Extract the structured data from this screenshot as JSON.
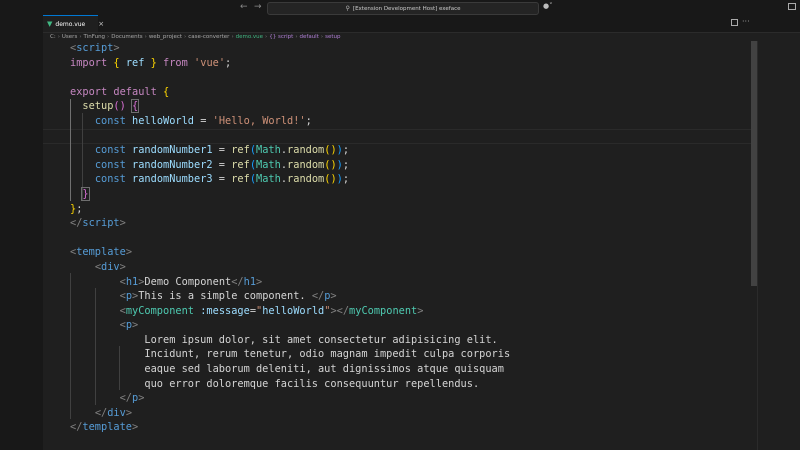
{
  "titlebar": {
    "back_icon": "arrow-left-icon",
    "forward_icon": "arrow-right-icon",
    "command_center": "[Extension Development Host] exeface",
    "copilot_icon": "copilot-icon"
  },
  "tab": {
    "label": "demo.vue",
    "close": "×"
  },
  "breadcrumb": [
    {
      "text": "C:"
    },
    {
      "text": "Users"
    },
    {
      "text": "TinFung"
    },
    {
      "text": "Documents"
    },
    {
      "text": "web_project"
    },
    {
      "text": "case-converter"
    },
    {
      "text": "demo.vue",
      "kind": "vue"
    },
    {
      "text": "{} script",
      "kind": "sym"
    },
    {
      "text": "default",
      "kind": "sym"
    },
    {
      "text": "setup",
      "kind": "sym"
    }
  ],
  "code": [
    [
      [
        "t-br",
        "<"
      ],
      [
        "t-tag",
        "script"
      ],
      [
        "t-br",
        ">"
      ]
    ],
    [
      [
        "t-kw2",
        "import"
      ],
      [
        "t-txt",
        " "
      ],
      [
        "t-y",
        "{"
      ],
      [
        "t-txt",
        " "
      ],
      [
        "t-var",
        "ref"
      ],
      [
        "t-txt",
        " "
      ],
      [
        "t-y",
        "}"
      ],
      [
        "t-txt",
        " "
      ],
      [
        "t-kw2",
        "from"
      ],
      [
        "t-txt",
        " "
      ],
      [
        "t-str",
        "'vue'"
      ],
      [
        "t-txt",
        ";"
      ]
    ],
    [],
    [
      [
        "t-kw2",
        "export"
      ],
      [
        "t-txt",
        " "
      ],
      [
        "t-kw2",
        "default"
      ],
      [
        "t-txt",
        " "
      ],
      [
        "t-y",
        "{"
      ]
    ],
    [
      [
        "t-txt",
        "  "
      ],
      [
        "t-fn",
        "setup"
      ],
      [
        "t-p",
        "()"
      ],
      [
        "t-txt",
        " "
      ],
      [
        "t-p bracket-box",
        "{"
      ]
    ],
    [
      [
        "t-txt",
        "    "
      ],
      [
        "t-kw",
        "const"
      ],
      [
        "t-txt",
        " "
      ],
      [
        "t-var",
        "helloWorld"
      ],
      [
        "t-txt",
        " = "
      ],
      [
        "t-str",
        "'Hello, World!'"
      ],
      [
        "t-txt",
        ";"
      ]
    ],
    [],
    [
      [
        "t-txt",
        "    "
      ],
      [
        "t-kw",
        "const"
      ],
      [
        "t-txt",
        " "
      ],
      [
        "t-var",
        "randomNumber1"
      ],
      [
        "t-txt",
        " = "
      ],
      [
        "t-fn",
        "ref"
      ],
      [
        "t-b",
        "("
      ],
      [
        "t-cls",
        "Math"
      ],
      [
        "t-txt",
        "."
      ],
      [
        "t-fn",
        "random"
      ],
      [
        "t-y",
        "()"
      ],
      [
        "t-b",
        ")"
      ],
      [
        "t-txt",
        ";"
      ]
    ],
    [
      [
        "t-txt",
        "    "
      ],
      [
        "t-kw",
        "const"
      ],
      [
        "t-txt",
        " "
      ],
      [
        "t-var",
        "randomNumber2"
      ],
      [
        "t-txt",
        " = "
      ],
      [
        "t-fn",
        "ref"
      ],
      [
        "t-b",
        "("
      ],
      [
        "t-cls",
        "Math"
      ],
      [
        "t-txt",
        "."
      ],
      [
        "t-fn",
        "random"
      ],
      [
        "t-y",
        "()"
      ],
      [
        "t-b",
        ")"
      ],
      [
        "t-txt",
        ";"
      ]
    ],
    [
      [
        "t-txt",
        "    "
      ],
      [
        "t-kw",
        "const"
      ],
      [
        "t-txt",
        " "
      ],
      [
        "t-var",
        "randomNumber3"
      ],
      [
        "t-txt",
        " = "
      ],
      [
        "t-fn",
        "ref"
      ],
      [
        "t-b",
        "("
      ],
      [
        "t-cls",
        "Math"
      ],
      [
        "t-txt",
        "."
      ],
      [
        "t-fn",
        "random"
      ],
      [
        "t-y",
        "()"
      ],
      [
        "t-b",
        ")"
      ],
      [
        "t-txt",
        ";"
      ]
    ],
    [
      [
        "t-txt",
        "  "
      ],
      [
        "t-p bracket-box",
        "}"
      ]
    ],
    [
      [
        "t-y",
        "}"
      ],
      [
        "t-txt",
        ";"
      ]
    ],
    [
      [
        "t-br",
        "</"
      ],
      [
        "t-tag",
        "script"
      ],
      [
        "t-br",
        ">"
      ]
    ],
    [],
    [
      [
        "t-br",
        "<"
      ],
      [
        "t-tag",
        "template"
      ],
      [
        "t-br",
        ">"
      ]
    ],
    [
      [
        "t-txt",
        "    "
      ],
      [
        "t-br",
        "<"
      ],
      [
        "t-tag",
        "div"
      ],
      [
        "t-br",
        ">"
      ]
    ],
    [
      [
        "t-txt",
        "        "
      ],
      [
        "t-br",
        "<"
      ],
      [
        "t-tag",
        "h1"
      ],
      [
        "t-br",
        ">"
      ],
      [
        "t-txt",
        "Demo Component"
      ],
      [
        "t-br",
        "</"
      ],
      [
        "t-tag",
        "h1"
      ],
      [
        "t-br",
        ">"
      ]
    ],
    [
      [
        "t-txt",
        "        "
      ],
      [
        "t-br",
        "<"
      ],
      [
        "t-tag",
        "p"
      ],
      [
        "t-br",
        ">"
      ],
      [
        "t-txt",
        "This is a simple component. "
      ],
      [
        "t-br",
        "</"
      ],
      [
        "t-tag",
        "p"
      ],
      [
        "t-br",
        ">"
      ]
    ],
    [
      [
        "t-txt",
        "        "
      ],
      [
        "t-br",
        "<"
      ],
      [
        "t-comp",
        "myComponent"
      ],
      [
        "t-txt",
        " "
      ],
      [
        "t-var",
        ":message"
      ],
      [
        "t-txt",
        "="
      ],
      [
        "t-str",
        "\""
      ],
      [
        "t-var",
        "helloWorld"
      ],
      [
        "t-str",
        "\""
      ],
      [
        "t-br",
        "></"
      ],
      [
        "t-comp",
        "myComponent"
      ],
      [
        "t-br",
        ">"
      ]
    ],
    [
      [
        "t-txt",
        "        "
      ],
      [
        "t-br",
        "<"
      ],
      [
        "t-tag",
        "p"
      ],
      [
        "t-br",
        ">"
      ]
    ],
    [
      [
        "t-txt",
        "            Lorem ipsum dolor, sit amet consectetur adipisicing elit."
      ]
    ],
    [
      [
        "t-txt",
        "            Incidunt, rerum tenetur, odio magnam impedit culpa corporis"
      ]
    ],
    [
      [
        "t-txt",
        "            eaque sed laborum deleniti, aut dignissimos atque quisquam"
      ]
    ],
    [
      [
        "t-txt",
        "            quo error doloremque facilis consequuntur repellendus."
      ]
    ],
    [
      [
        "t-txt",
        "        "
      ],
      [
        "t-br",
        "</"
      ],
      [
        "t-tag",
        "p"
      ],
      [
        "t-br",
        ">"
      ]
    ],
    [
      [
        "t-txt",
        "    "
      ],
      [
        "t-br",
        "</"
      ],
      [
        "t-tag",
        "div"
      ],
      [
        "t-br",
        ">"
      ]
    ],
    [
      [
        "t-br",
        "</"
      ],
      [
        "t-tag",
        "template"
      ],
      [
        "t-br",
        ">"
      ]
    ]
  ]
}
